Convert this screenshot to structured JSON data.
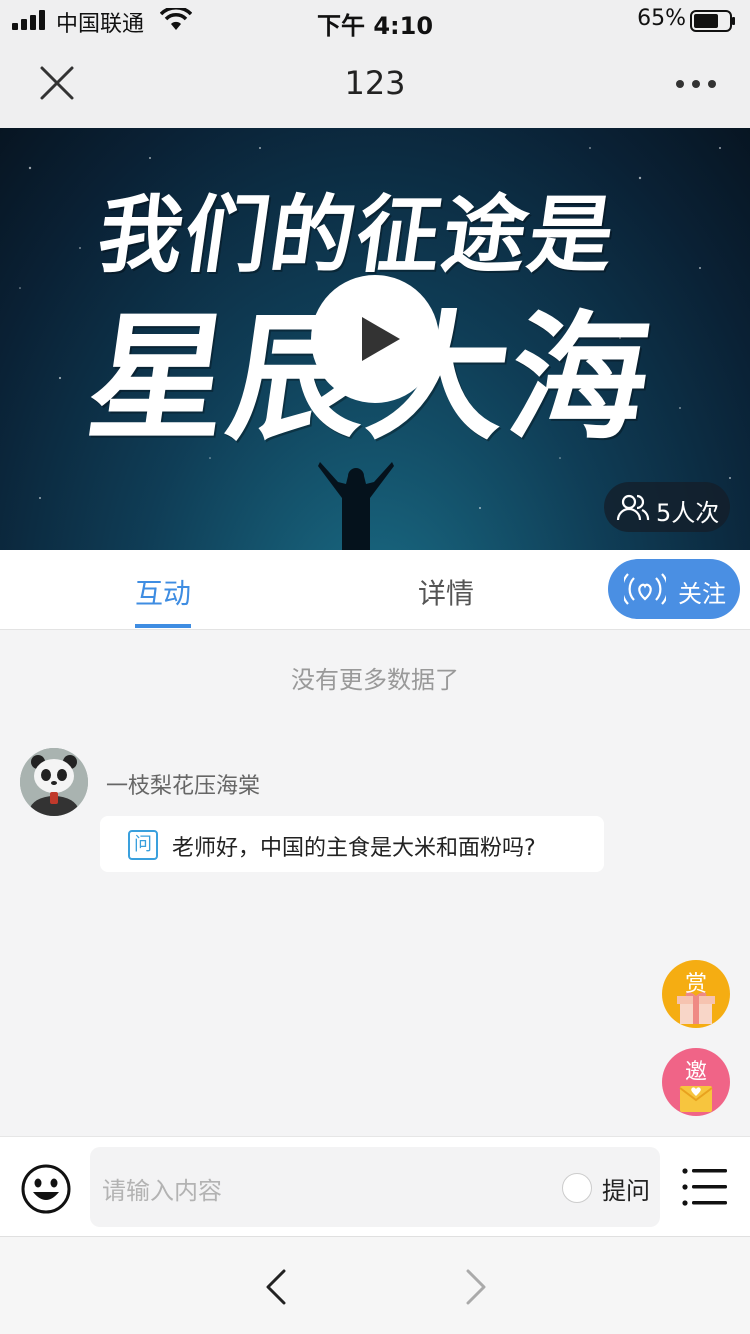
{
  "status_bar": {
    "carrier": "中国联通",
    "time": "下午 4:10",
    "battery": "65%"
  },
  "nav": {
    "title": "123"
  },
  "video": {
    "title_line1": "我们的征途是",
    "title_line2": "星辰大海",
    "viewer_count": "5人次"
  },
  "tabs": [
    {
      "label": "互动",
      "active": true
    },
    {
      "label": "详情",
      "active": false
    }
  ],
  "follow_label": "关注",
  "feed": {
    "empty_notice": "没有更多数据了",
    "messages": [
      {
        "username": "一枝梨花压海棠",
        "badge": "问",
        "text": "老师好，中国的主食是大米和面粉吗?"
      }
    ]
  },
  "fabs": {
    "reward_label": "赏",
    "invite_label": "邀"
  },
  "input": {
    "placeholder": "请输入内容",
    "ask_label": "提问"
  },
  "colors": {
    "accent": "#3f8de2",
    "reward": "#f5ad12",
    "invite": "#f06487"
  }
}
